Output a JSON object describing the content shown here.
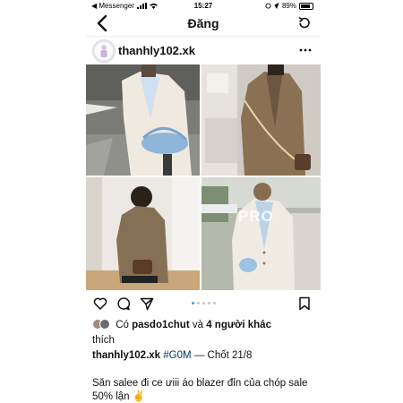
{
  "status_bar": {
    "carrier": "◀ Messenger",
    "time": "15:27",
    "battery": "89%"
  },
  "nav": {
    "title": "Đăng"
  },
  "post": {
    "username": "thanhly102.xk",
    "image_watermark": "PRO",
    "carousel": {
      "count": 5,
      "active": 1
    },
    "likes": {
      "prefix": "Có",
      "user": "pasdo1chut",
      "middle": "và",
      "others": "4 người khác",
      "suffix": "thích"
    },
    "caption": {
      "username": "thanhly102.xk",
      "hashtag": "#G0M",
      "text": "— Chốt 21/8"
    },
    "description": "Săn salee đi ce ưiii áo blazer đỉn của chóp sale 50% lận ✌️"
  },
  "colors": {
    "link": "#00376b",
    "carousel_active": "#3897f0",
    "blazer_cream": "#efe9df",
    "blazer_brown": "#8b7153"
  }
}
